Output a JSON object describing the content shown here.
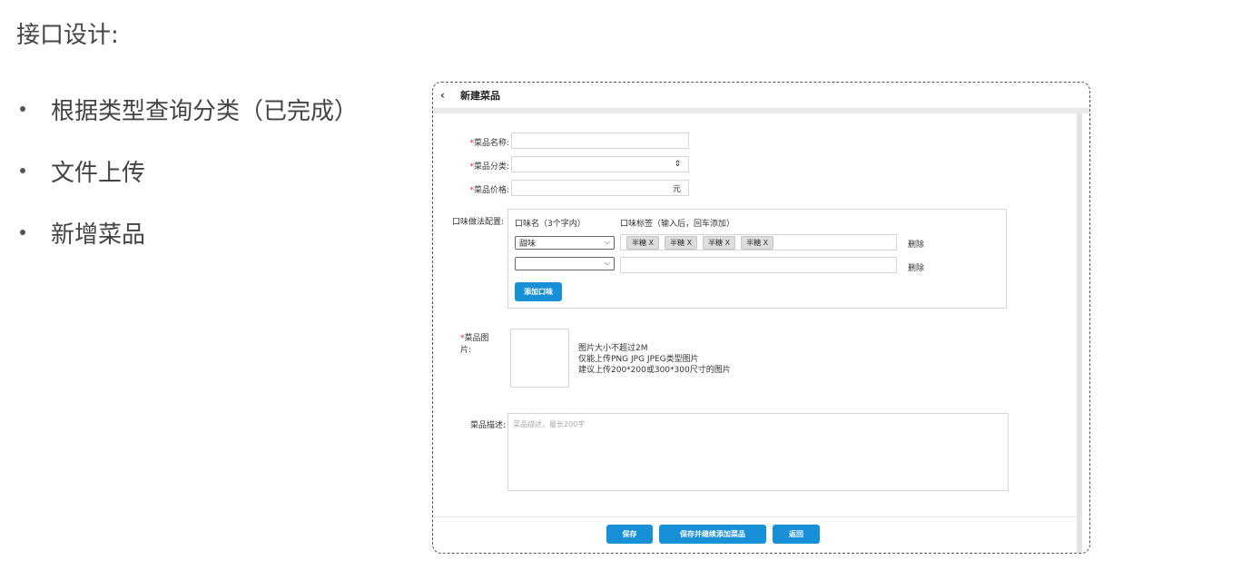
{
  "slide": {
    "title": "接口设计:",
    "bullets": [
      "根据类型查询分类（已完成）",
      "文件上传",
      "新增菜品"
    ]
  },
  "window": {
    "title": "新建菜品",
    "fields": {
      "name_label": "菜品名称:",
      "category_label": "菜品分类:",
      "category_arrow": "⇕",
      "price_label": "菜品价格:",
      "price_unit": "元",
      "flavor_label": "口味做法配置:",
      "image_label": "菜品图片:",
      "desc_label": "菜品描述:",
      "desc_placeholder": "菜品描述，最长200字"
    },
    "flavor": {
      "col_name": "口味名（3个字内）",
      "col_tags": "口味标签（输入后，回车添加）",
      "rows": [
        {
          "name": "甜味",
          "tags": [
            "半糖 X",
            "半糖 X",
            "半糖 X",
            "半糖 X"
          ],
          "delete": "删除"
        },
        {
          "name": "",
          "tags": [],
          "delete": "删除"
        }
      ],
      "add_button": "添加口味"
    },
    "image_hints": [
      "图片大小不超过2M",
      "仅能上传PNG JPG JPEG类型图片",
      "建议上传200*200或300*300尺寸的图片"
    ],
    "buttons": {
      "save": "保存",
      "save_continue": "保存并继续添加菜品",
      "back": "返回"
    }
  },
  "colors": {
    "accent": "#1890d8",
    "required": "#e24444"
  }
}
